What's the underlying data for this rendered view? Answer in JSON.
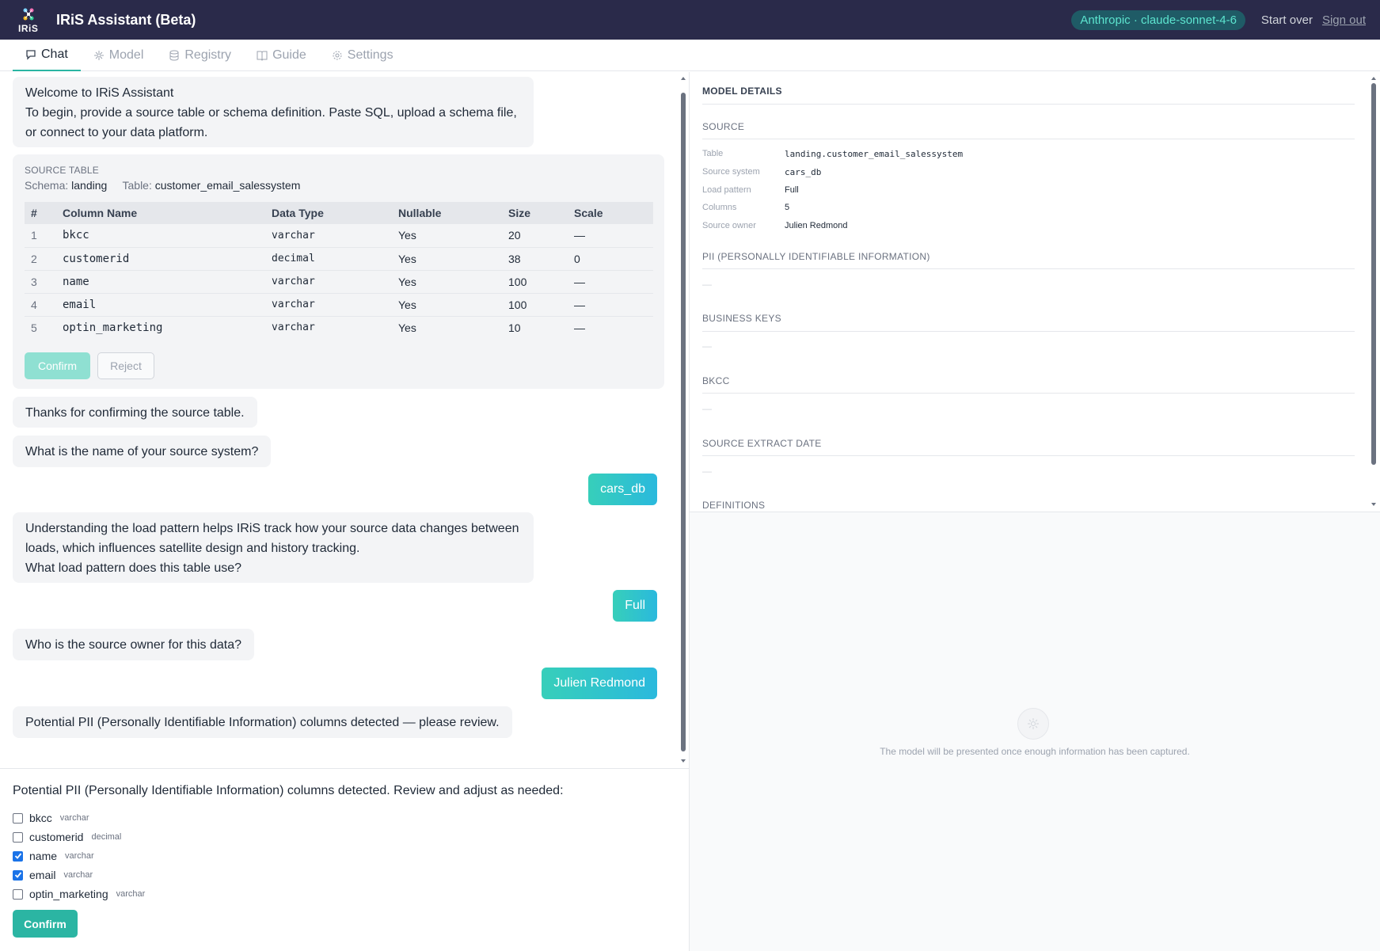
{
  "header": {
    "logo_text": "IRiS",
    "title": "IRiS Assistant (Beta)",
    "model_badge": "Anthropic · claude-sonnet-4-6",
    "start_over": "Start over",
    "sign_out": "Sign out"
  },
  "tabs": [
    {
      "label": "Chat",
      "icon": "chat-icon",
      "active": true
    },
    {
      "label": "Model",
      "icon": "model-icon",
      "active": false
    },
    {
      "label": "Registry",
      "icon": "database-icon",
      "active": false
    },
    {
      "label": "Guide",
      "icon": "book-icon",
      "active": false
    },
    {
      "label": "Settings",
      "icon": "gear-icon",
      "active": false
    }
  ],
  "chat": {
    "welcome_title": "Welcome to IRiS Assistant",
    "welcome_body": "To begin, provide a source table or schema definition. Paste SQL, upload a schema file, or connect to your data platform.",
    "source_card": {
      "label": "SOURCE TABLE",
      "schema_key": "Schema:",
      "schema_val": "landing",
      "table_key": "Table:",
      "table_val": "customer_email_salessystem",
      "headers": [
        "#",
        "Column Name",
        "Data Type",
        "Nullable",
        "Size",
        "Scale"
      ],
      "rows": [
        [
          "1",
          "bkcc",
          "varchar",
          "Yes",
          "20",
          "—"
        ],
        [
          "2",
          "customerid",
          "decimal",
          "Yes",
          "38",
          "0"
        ],
        [
          "3",
          "name",
          "varchar",
          "Yes",
          "100",
          "—"
        ],
        [
          "4",
          "email",
          "varchar",
          "Yes",
          "100",
          "—"
        ],
        [
          "5",
          "optin_marketing",
          "varchar",
          "Yes",
          "10",
          "—"
        ]
      ],
      "confirm": "Confirm",
      "reject": "Reject"
    },
    "msg_thanks": "Thanks for confirming the source table.",
    "msg_system_q": "What is the name of your source system?",
    "user_system": "cars_db",
    "msg_load_1": "Understanding the load pattern helps IRiS track how your source data changes between loads, which influences satellite design and history tracking.",
    "msg_load_2": "What load pattern does this table use?",
    "user_load": "Full",
    "msg_owner_q": "Who is the source owner for this data?",
    "user_owner": "Julien Redmond",
    "msg_pii": "Potential PII (Personally Identifiable Information) columns detected — please review."
  },
  "pii_panel": {
    "title": "Potential PII (Personally Identifiable Information) columns detected. Review and adjust as needed:",
    "items": [
      {
        "name": "bkcc",
        "type": "varchar",
        "checked": false
      },
      {
        "name": "customerid",
        "type": "decimal",
        "checked": false
      },
      {
        "name": "name",
        "type": "varchar",
        "checked": true
      },
      {
        "name": "email",
        "type": "varchar",
        "checked": true
      },
      {
        "name": "optin_marketing",
        "type": "varchar",
        "checked": false
      }
    ],
    "confirm": "Confirm"
  },
  "details": {
    "title": "MODEL DETAILS",
    "source_heading": "SOURCE",
    "fields": [
      {
        "key": "Table",
        "value": "landing.customer_email_salessystem"
      },
      {
        "key": "Source system",
        "value": "cars_db"
      },
      {
        "key": "Load pattern",
        "value": "Full"
      },
      {
        "key": "Columns",
        "value": "5"
      },
      {
        "key": "Source owner",
        "value": "Julien Redmond"
      }
    ],
    "pii_heading": "PII (PERSONALLY IDENTIFIABLE INFORMATION)",
    "bk_heading": "BUSINESS KEYS",
    "bkcc_heading": "BKCC",
    "extract_heading": "SOURCE EXTRACT DATE",
    "definitions_heading": "DEFINITIONS",
    "empty": "—"
  },
  "model_area": {
    "message": "The model will be presented once enough information has been captured."
  },
  "colors": {
    "topbar": "#2a2a4a",
    "accent": "#2bb5a3",
    "user_bubble_from": "#37cfba",
    "user_bubble_to": "#2ab9dd"
  }
}
